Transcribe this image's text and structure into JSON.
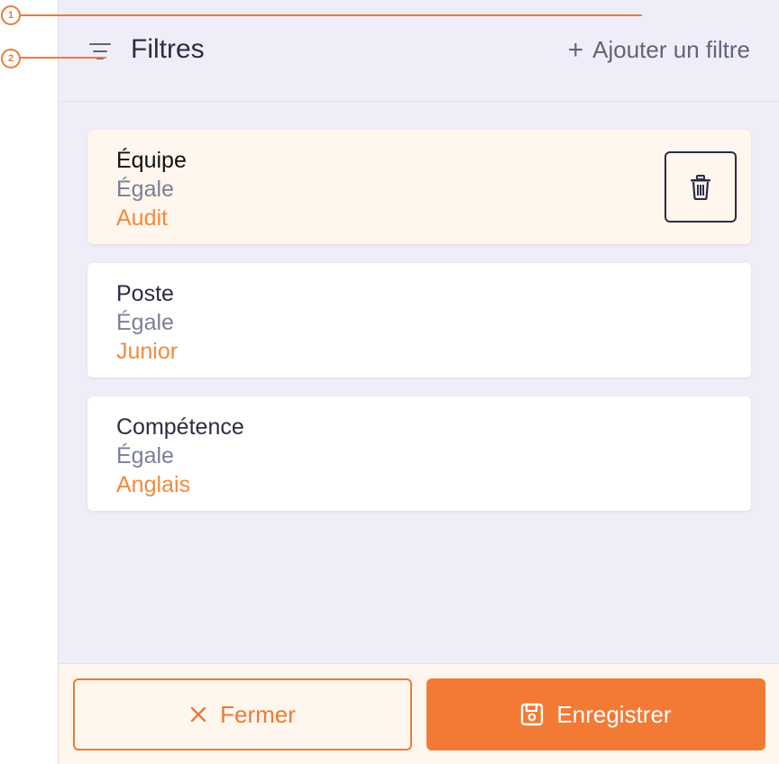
{
  "annotations": [
    "1",
    "2"
  ],
  "header": {
    "title": "Filtres",
    "add_filter_label": "Ajouter un filtre"
  },
  "filters": [
    {
      "field": "Équipe",
      "operator": "Égale",
      "value": "Audit"
    },
    {
      "field": "Poste",
      "operator": "Égale",
      "value": "Junior"
    },
    {
      "field": "Compétence",
      "operator": "Égale",
      "value": "Anglais"
    }
  ],
  "footer": {
    "close_label": "Fermer",
    "save_label": "Enregistrer"
  },
  "colors": {
    "accent": "#f37a35",
    "panel_bg": "#efeef8",
    "active_card_bg": "#fff6ee",
    "text_dark": "#2a2d44",
    "text_muted": "#7b7f96"
  }
}
